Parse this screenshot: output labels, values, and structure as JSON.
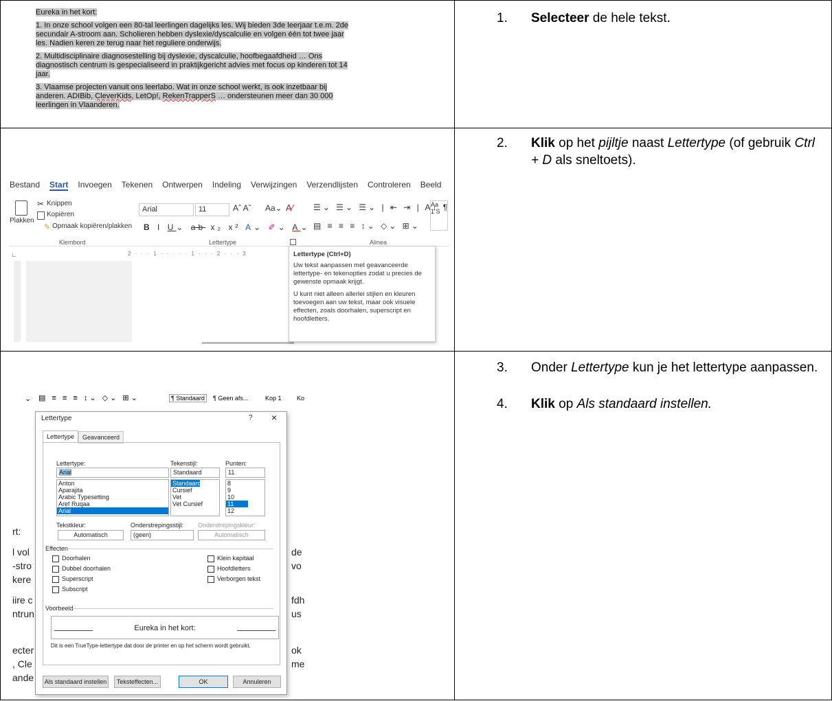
{
  "steps": [
    {
      "num": "1.",
      "bold": "Selecteer",
      "rest": " de hele tekst."
    },
    {
      "num": "2.",
      "bold": "Klik",
      "a": " op het ",
      "italic1": "pijltje",
      "b": " naast ",
      "italic2": "Lettertype",
      "c": " (of gebruik ",
      "italic3": "Ctrl + D",
      "d": " als sneltoets)."
    },
    {
      "num": "3.",
      "a": "Onder ",
      "italic": "Lettertype",
      "b": " kun je het lettertype aanpassen."
    },
    {
      "num": "4.",
      "bold": "Klik",
      "a": " op ",
      "italic": "Als standaard instellen."
    }
  ],
  "doc_text": {
    "title": "Eureka in het kort:",
    "p1": "1. In onze school volgen een 80-tal leerlingen dagelijks les. Wij bieden 3de leerjaar t.e.m. 2de secundair A-stroom aan. Scholieren hebben dyslexie/dyscalculie en volgen één tot twee jaar les. Nadien keren ze terug naar het reguliere onderwijs.",
    "p2": "2. Multidisciplinaire diagnosestelling bij dyslexie, dyscalculie, hoofbegaafdheid … Ons diagnostisch centrum is gespecialiseerd in praktijkgericht advies met focus op kinderen tot 14 jaar.",
    "p3a": "3. Vlaamse projecten vanuit ons leerlabo. Wat in onze school werkt, is ook inzetbaar bij anderen. ADIBib, ",
    "p3_cleverkids": "CleverKids",
    "p3b": ", LetOp!, ",
    "p3_reken": "RekenTrapperS",
    "p3c": " … ondersteunen meer dan 30 000 leerlingen in Vlaanderen."
  },
  "ribbon": {
    "tabs": [
      "Bestand",
      "Start",
      "Invoegen",
      "Tekenen",
      "Ontwerpen",
      "Indeling",
      "Verwijzingen",
      "Verzendlijsten",
      "Controleren",
      "Beeld"
    ],
    "knippen": "Knippen",
    "kopieren": "Kopiëren",
    "opmaak": "Opmaak kopiëren/plakken",
    "plakken": "Plakken",
    "font": "Arial",
    "size": "11",
    "group_klembord": "Klembord",
    "group_lettertype": "Lettertype",
    "group_alinea": "Alinea",
    "ruler": "2 · · · 1 · · · · · 1 · · · 2 · · · 3",
    "tooltip_title": "Lettertype (Ctrl+D)",
    "tooltip_p1": "Uw tekst aanpassen met geavanceerde lettertype- en tekenopties zodat u precies de gewenste opmaak krijgt.",
    "tooltip_p2": "U kunt niet alleen allerlei stijlen en kleuren toevoegen aan uw tekst, maar ook visuele effecten, zoals doorhalen, superscript en hoofdletters."
  },
  "dialog": {
    "toolbar_styles": [
      "¶ Standaard",
      "¶ Geen afs...",
      "Kop 1",
      "Ko"
    ],
    "title": "Lettertype",
    "help": "?",
    "close": "×",
    "tab1": "Lettertype",
    "tab2": "Geavanceerd",
    "lbl_font": "Lettertype:",
    "lbl_style": "Tekenstijl:",
    "lbl_size": "Punten:",
    "font_value": "Arial",
    "style_value": "Standaard",
    "size_value": "11",
    "font_list": [
      "Anton",
      "Aparajita",
      "Arabic Typesetting",
      "Aref Ruqaa",
      "Arial"
    ],
    "style_list": [
      "Standaard",
      "Cursief",
      "Vet",
      "Vet Cursief"
    ],
    "size_list": [
      "8",
      "9",
      "10",
      "11",
      "12"
    ],
    "lbl_color": "Tekstkleur:",
    "lbl_underline": "Onderstrepingsstijl:",
    "lbl_ucolor": "Onderstrepingskleur:",
    "color_value": "Automatisch",
    "underline_value": "(geen)",
    "ucolor_value": "Automatisch",
    "effects": "Effecten",
    "eff_left": [
      "Doorhalen",
      "Dubbel doorhalen",
      "Superscript",
      "Subscript"
    ],
    "eff_right": [
      "Klein kapitaal",
      "Hoofdletters",
      "Verborgen tekst"
    ],
    "preview_label": "Voorbeeld",
    "preview_text": "Eureka in het kort:",
    "truetype_note": "Dit is een TrueType-lettertype dat door de printer en op het scherm wordt gebruikt.",
    "btn_default": "Als standaard instellen",
    "btn_effects": "Teksteffecten...",
    "btn_ok": "OK",
    "btn_cancel": "Annuleren",
    "bg_left": [
      "rt:",
      "l vol",
      "-stro",
      "kere",
      "iire c",
      "ntrun",
      "ecter",
      ", Cle",
      "ande"
    ],
    "bg_right": [
      "de",
      "vo",
      "fdh",
      "us",
      "ok",
      "me"
    ]
  },
  "colors": {
    "selection": "#c8c8c8",
    "word_blue": "#2b579a",
    "list_select": "#0078d7"
  }
}
